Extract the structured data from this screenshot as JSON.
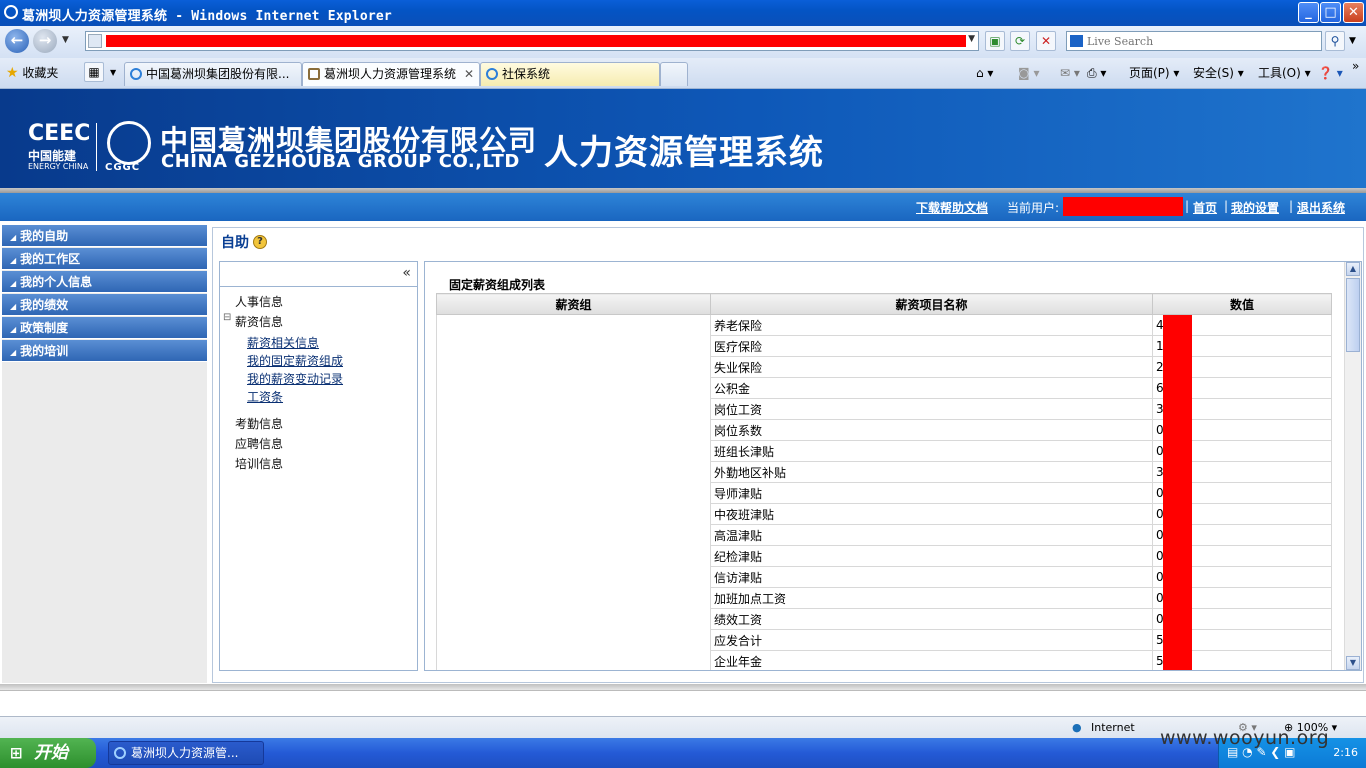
{
  "window": {
    "title": "葛洲坝人力资源管理系统 - Windows Internet Explorer",
    "buttons": [
      "_",
      "□",
      "✕"
    ]
  },
  "addressbar": {
    "search_placeholder": "Live Search"
  },
  "tabs": {
    "favorites_label": "收藏夹",
    "items": [
      "中国葛洲坝集团股份有限...",
      "葛洲坝人力资源管理系统",
      "社保系统"
    ],
    "tools": [
      "页面(P)",
      "安全(S)",
      "工具(O)"
    ]
  },
  "banner": {
    "logo_mark": "CEEC",
    "logo_cn": "中国能建",
    "logo_en": "ENERGY CHINA",
    "cgg": "CGGC",
    "company_cn": "中国葛洲坝集团股份有限公司",
    "company_en": "CHINA GEZHOUBA GROUP CO.,LTD",
    "system_name": "人力资源管理系统"
  },
  "userbar": {
    "download_help": "下载帮助文档",
    "current_user_label": "当前用户:",
    "home": "首页",
    "my_settings": "我的设置",
    "logout": "退出系统"
  },
  "leftmenu": {
    "items": [
      "我的自助",
      "我的工作区",
      "我的个人信息",
      "我的绩效",
      "政策制度",
      "我的培训"
    ]
  },
  "page": {
    "title": "自助",
    "collapse": "«"
  },
  "tree": {
    "personnel": "人事信息",
    "salary": "薪资信息",
    "salary_links": [
      "薪资相关信息",
      "我的固定薪资组成",
      "我的薪资变动记录",
      "工资条"
    ],
    "attendance": "考勤信息",
    "recruit": "应聘信息",
    "training": "培训信息"
  },
  "table": {
    "title": "固定薪资组成列表",
    "headers": [
      "薪资组",
      "薪资项目名称",
      "数值"
    ],
    "rows": [
      {
        "item": "养老保险",
        "value": "4"
      },
      {
        "item": "医疗保险",
        "value": "1"
      },
      {
        "item": "失业保险",
        "value": "2"
      },
      {
        "item": "公积金",
        "value": "6"
      },
      {
        "item": "岗位工资",
        "value": "3"
      },
      {
        "item": "岗位系数",
        "value": "0"
      },
      {
        "item": "班组长津贴",
        "value": "0"
      },
      {
        "item": "外勤地区补贴",
        "value": "3"
      },
      {
        "item": "导师津贴",
        "value": "0"
      },
      {
        "item": "中夜班津贴",
        "value": "0"
      },
      {
        "item": "高温津贴",
        "value": "0"
      },
      {
        "item": "纪检津贴",
        "value": "0"
      },
      {
        "item": "信访津贴",
        "value": "0"
      },
      {
        "item": "加班加点工资",
        "value": "0"
      },
      {
        "item": "绩效工资",
        "value": "0"
      },
      {
        "item": "应发合计",
        "value": "5"
      },
      {
        "item": "企业年金",
        "value": "5"
      }
    ]
  },
  "statusbar": {
    "zone": "Internet",
    "zoom": "100%"
  },
  "taskbar": {
    "start": "开始",
    "task": "葛洲坝人力资源管...",
    "clock": "2:16"
  },
  "watermark": "www.wooyun.org",
  "colors": {
    "redaction": "#ff0000",
    "menu_blue": "#2f66b4",
    "banner_blue": "#0e58b8"
  }
}
